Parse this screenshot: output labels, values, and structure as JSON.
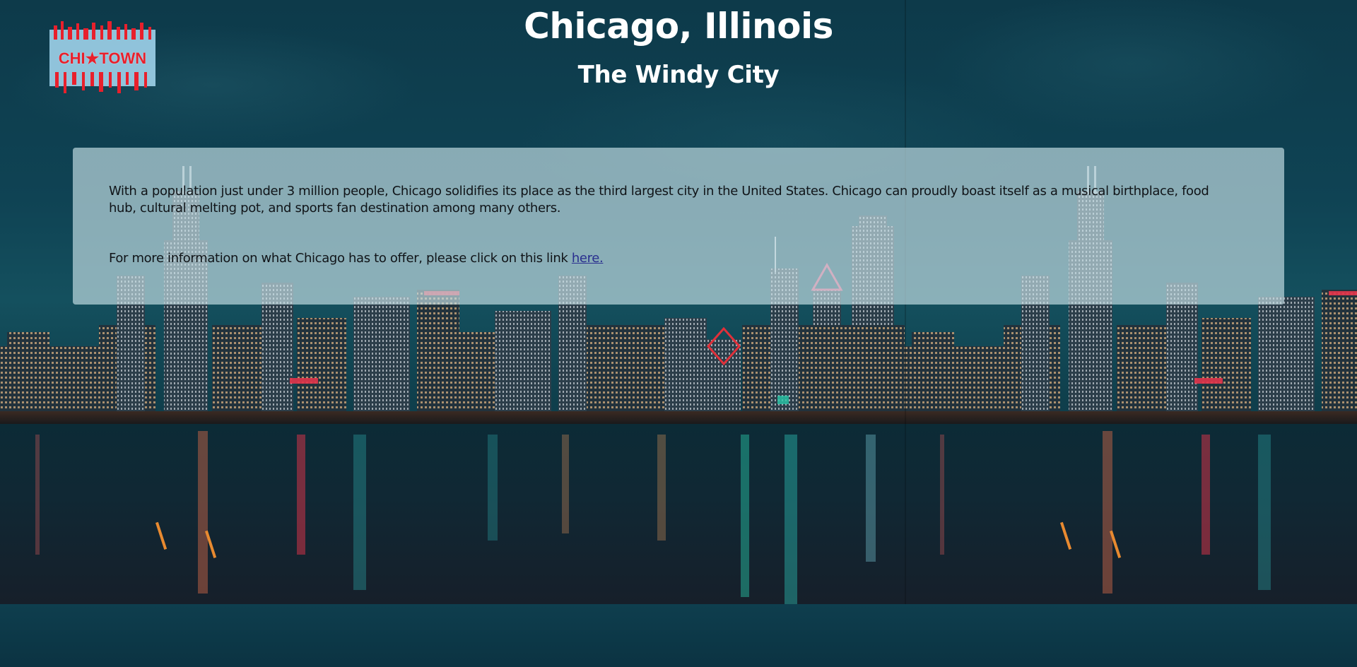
{
  "logo": {
    "text": "CHI★TOWN",
    "colors": {
      "red": "#e8202c",
      "blue": "#9fd2ea"
    }
  },
  "header": {
    "title": "Chicago, Illinois",
    "subtitle": "The Windy City"
  },
  "content": {
    "paragraph_1": "With a population just under 3 million people, Chicago solidifies its place as the third largest city in the United States. Chicago can proudly boast itself as a musical birthplace, food hub, cultural melting pot, and sports fan destination among many others.",
    "paragraph_2_prefix": "For more information on what Chicago has to offer, please click on this link ",
    "link_text": "here."
  },
  "background": {
    "description_icon": "chicago-skyline-night-image",
    "colors": {
      "sky": "#0f4354",
      "water": "#102834",
      "panel": "#c8e2e8"
    }
  }
}
